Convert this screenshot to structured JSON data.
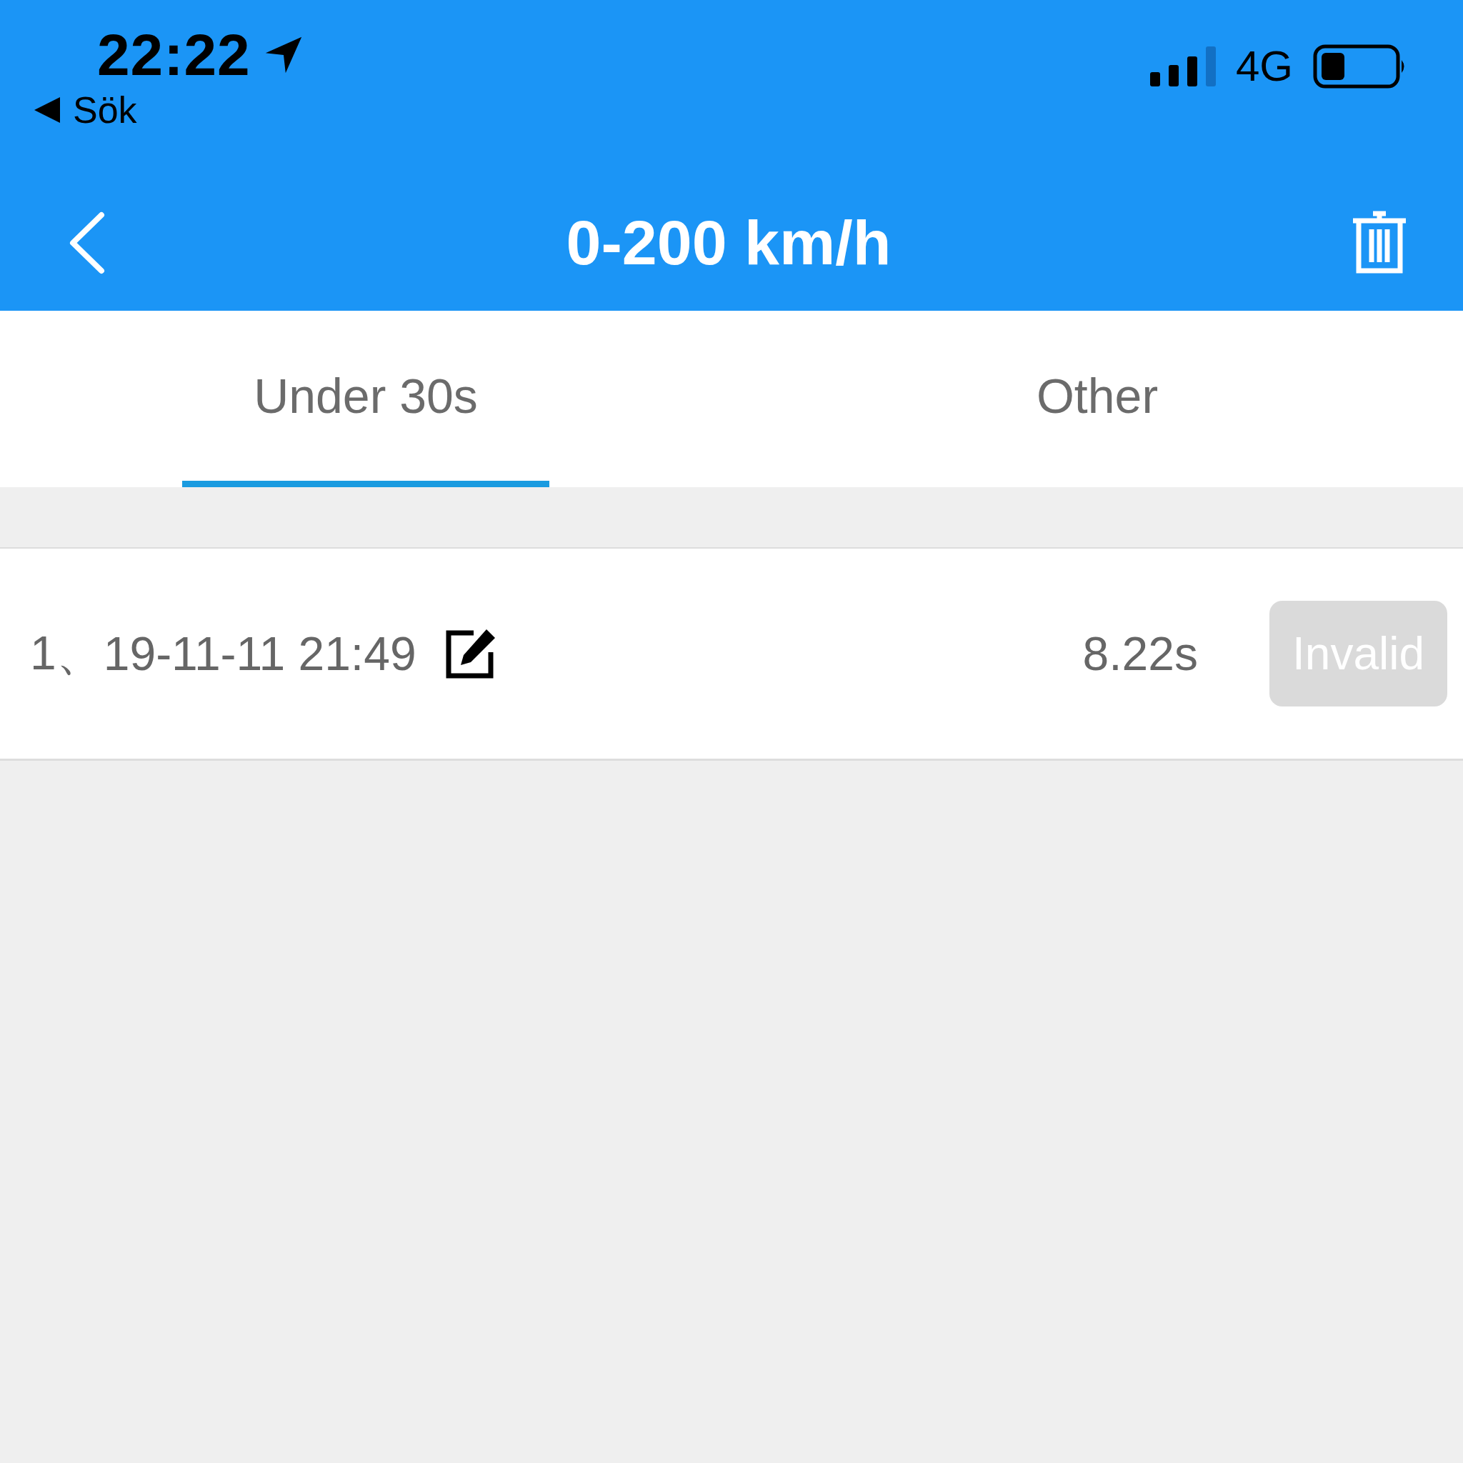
{
  "status_bar": {
    "time": "22:22",
    "back_app": "Sök",
    "network": "4G"
  },
  "nav_bar": {
    "title": "0-200 km/h"
  },
  "tabs": [
    {
      "label": "Under 30s",
      "selected": true
    },
    {
      "label": "Other",
      "selected": false
    }
  ],
  "records": [
    {
      "index": "1、",
      "datetime": "19-11-11 21:49",
      "duration": "8.22s",
      "action": "Invalid"
    }
  ]
}
